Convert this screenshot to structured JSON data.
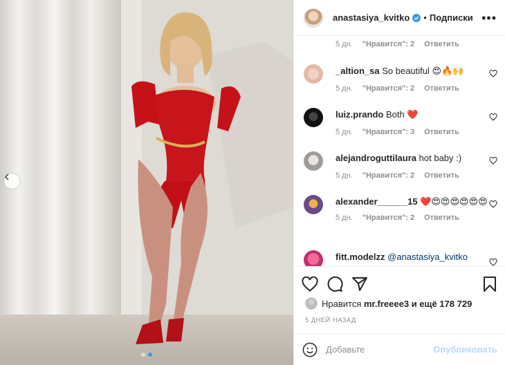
{
  "header": {
    "username": "anastasiya_kvitko",
    "separator": "•",
    "follow_label": "Подписки",
    "more_label": "•••"
  },
  "first_meta": {
    "time": "5 дн.",
    "likes": "\"Нравится\": 2",
    "reply": "Ответить"
  },
  "comments": [
    {
      "user": "_altion_sa",
      "text": "So beautiful 😍🔥🙌",
      "time": "5 дн.",
      "likes": "\"Нравится\": 2",
      "reply": "Ответить"
    },
    {
      "user": "luiz.prando",
      "text": "Both ❤️",
      "time": "5 дн.",
      "likes": "\"Нравится\": 3",
      "reply": "Ответить"
    },
    {
      "user": "alejandroguttilaura",
      "text": "hot baby :)",
      "time": "5 дн.",
      "likes": "\"Нравится\": 2",
      "reply": "Ответить"
    },
    {
      "user": "alexander______15",
      "text": "❤️😍😍😍😍😍😍",
      "time": "5 дн.",
      "likes": "\"Нравится\": 2",
      "reply": "Ответить"
    },
    {
      "user": "fitt.modelzz",
      "text": "@anastasiya_kvitko",
      "time": "",
      "likes": "",
      "reply": ""
    }
  ],
  "likes": {
    "prefix": "Нравится",
    "user": "mr.freeee3",
    "suffix": "и ещё 178 729"
  },
  "date": "5 ДНЕЙ НАЗАД",
  "add_comment": {
    "placeholder": "Добавьте",
    "post_label": "Опубликовать"
  },
  "colors": {
    "accent": "#3897f0",
    "verified": "#3897f0",
    "post_disabled": "#b3dbff",
    "like_red": "#ed4956"
  },
  "icons": [
    "verified-badge-icon",
    "heart-icon",
    "comment-icon",
    "share-icon",
    "bookmark-icon",
    "emoji-icon",
    "carousel-prev-icon"
  ]
}
